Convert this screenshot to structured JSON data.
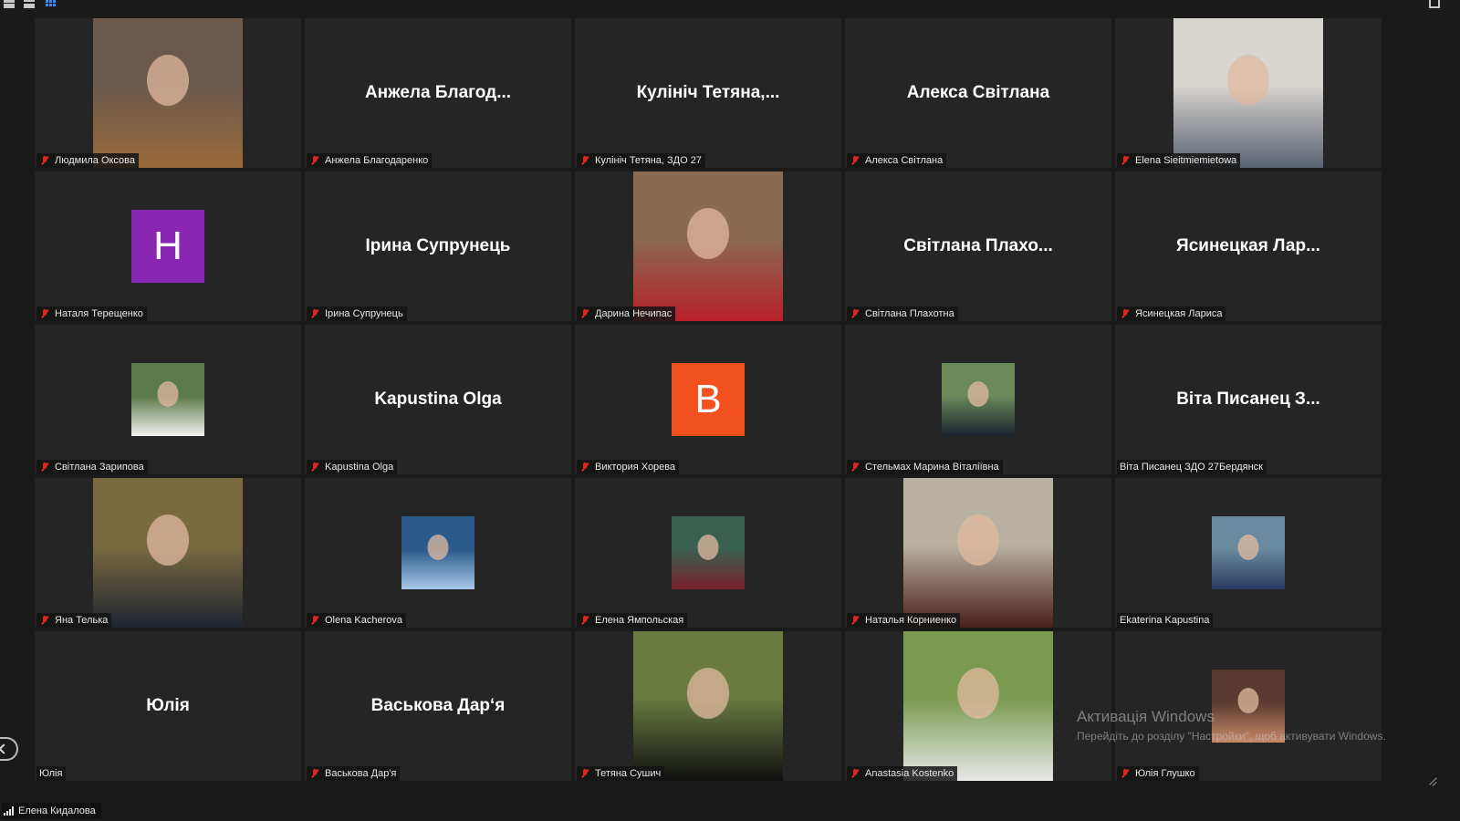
{
  "app": {
    "title": "Zoom"
  },
  "toolbar": {
    "views": [
      "speaker-view",
      "strip-view",
      "gallery-view"
    ],
    "active_view": "gallery-view"
  },
  "participants": [
    {
      "label": "Людмила Оксова",
      "muted": true,
      "kind": "video",
      "bg": "#6b5a4c",
      "accent": "#9a6a3a"
    },
    {
      "label": "Анжела Благодаренко",
      "big": "Анжела  Благод...",
      "muted": true,
      "kind": "name"
    },
    {
      "label": "Кулініч Тетяна, ЗДО 27",
      "big": "Кулініч  Тетяна,...",
      "muted": true,
      "kind": "name"
    },
    {
      "label": "Алекса Світлана",
      "big": "Алекса Світлана",
      "muted": true,
      "kind": "name"
    },
    {
      "label": "Elena Sieitmiemietowa",
      "muted": true,
      "kind": "video",
      "bg": "#d8d4d0",
      "accent": "#5a6270"
    },
    {
      "label": "Наталя Терещенко",
      "muted": true,
      "kind": "avatar",
      "letter": "Н",
      "color": "#8a26b4"
    },
    {
      "label": "Ірина Супрунець",
      "big": "Ірина Супрунець",
      "muted": true,
      "kind": "name"
    },
    {
      "label": "Дарина Нечипас",
      "muted": true,
      "kind": "video",
      "bg": "#8a6a50",
      "accent": "#b8202a"
    },
    {
      "label": "Світлана Плахотна",
      "big": "Світлана  Плахо...",
      "muted": true,
      "kind": "name"
    },
    {
      "label": "Ясинецкая Лариса",
      "big": "Ясинецкая  Лар...",
      "muted": true,
      "kind": "name"
    },
    {
      "label": "Світлана Зарипова",
      "muted": true,
      "kind": "thumb",
      "bg": "#5c7a4a",
      "accent": "#f0f0ec"
    },
    {
      "label": "Kapustina Olga",
      "big": "Kapustina Olga",
      "muted": true,
      "kind": "name"
    },
    {
      "label": "Виктория Хорева",
      "muted": true,
      "kind": "avatar",
      "letter": "В",
      "color": "#f2501e"
    },
    {
      "label": "Стельмах Марина Віталіївна",
      "muted": true,
      "kind": "thumb",
      "bg": "#6a8a5a",
      "accent": "#1c2230"
    },
    {
      "label": "Віта Писанец ЗДО 27Бердянск",
      "big": "Віта  Писанец  З...",
      "muted": false,
      "kind": "name"
    },
    {
      "label": "Яна Телька",
      "muted": true,
      "kind": "video",
      "bg": "#7a6a40",
      "accent": "#1e2530"
    },
    {
      "label": "Olena Kacherova",
      "muted": true,
      "kind": "thumb",
      "bg": "#2a5a8a",
      "accent": "#a8c8e8"
    },
    {
      "label": "Елена Ямпольская",
      "muted": true,
      "kind": "thumb",
      "bg": "#3a6050",
      "accent": "#7a2030"
    },
    {
      "label": "Наталья Корниенко",
      "muted": true,
      "kind": "video",
      "bg": "#b8b0a0",
      "accent": "#4a1e1a"
    },
    {
      "label": "Ekaterina Kapustina",
      "muted": false,
      "kind": "thumb",
      "bg": "#6a8aa0",
      "accent": "#2a3a60"
    },
    {
      "label": "Юлія",
      "big": "Юлія",
      "muted": false,
      "kind": "name"
    },
    {
      "label": "Васькова Дар'я",
      "big": "Васькова Дар‘я",
      "muted": true,
      "kind": "name"
    },
    {
      "label": "Тетяна Сушич",
      "muted": true,
      "kind": "video",
      "bg": "#6a7a40",
      "accent": "#101010"
    },
    {
      "label": "Anastasia Kostenko",
      "muted": true,
      "kind": "video",
      "bg": "#7a9a50",
      "accent": "#e8e8e8"
    },
    {
      "label": "Юлія Глушко",
      "muted": true,
      "kind": "thumb",
      "bg": "#5a3a30",
      "accent": "#c88a6a"
    }
  ],
  "watermark": {
    "title": "Активація Windows",
    "subtitle": "Перейдіть до розділу \"Настройки\", щоб активувати Windows."
  },
  "self": {
    "name": "Елена Кидалова"
  }
}
